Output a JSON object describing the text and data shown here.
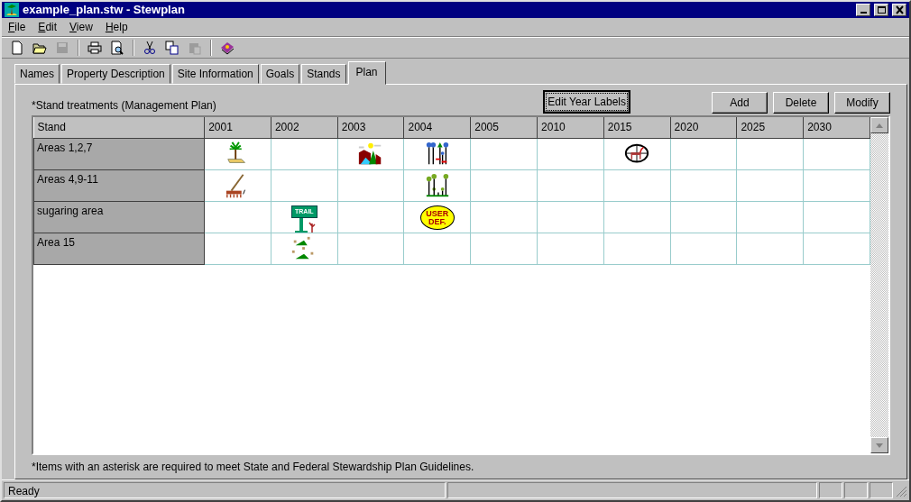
{
  "window": {
    "title": "example_plan.stw - Stewplan"
  },
  "menu": [
    "File",
    "Edit",
    "View",
    "Help"
  ],
  "toolbar": [
    {
      "kind": "new",
      "disabled": false
    },
    {
      "kind": "open",
      "disabled": false
    },
    {
      "kind": "save",
      "disabled": true
    },
    {
      "kind": "sep"
    },
    {
      "kind": "print",
      "disabled": false
    },
    {
      "kind": "preview",
      "disabled": false
    },
    {
      "kind": "sep"
    },
    {
      "kind": "cut",
      "disabled": false
    },
    {
      "kind": "copy",
      "disabled": false
    },
    {
      "kind": "paste",
      "disabled": true
    },
    {
      "kind": "sep"
    },
    {
      "kind": "book",
      "disabled": false
    }
  ],
  "tabs": [
    {
      "label": "Names",
      "selected": false
    },
    {
      "label": "Property Description",
      "selected": false
    },
    {
      "label": "Site Information",
      "selected": false
    },
    {
      "label": "Goals",
      "selected": false
    },
    {
      "label": "Stands",
      "selected": false
    },
    {
      "label": "Plan",
      "selected": true
    }
  ],
  "plan": {
    "caption": "*Stand treatments (Management Plan)",
    "edit_button": "Edit Year Labels",
    "buttons": [
      "Add",
      "Delete",
      "Modify"
    ],
    "columns": [
      "Stand",
      "2001",
      "2002",
      "2003",
      "2004",
      "2005",
      "2010",
      "2015",
      "2020",
      "2025",
      "2030"
    ],
    "rows": [
      {
        "cells": [
          {
            "kind": "stand",
            "text": "Areas 1,2,7"
          },
          {
            "kind": "seedling"
          },
          {},
          {
            "kind": "scenic"
          },
          {
            "kind": "marked-trees"
          },
          {},
          {},
          {
            "kind": "wildlife"
          },
          {},
          {},
          {}
        ]
      },
      {
        "cells": [
          {
            "kind": "stand",
            "text": "Areas 4,9-11"
          },
          {
            "kind": "rake"
          },
          {},
          {},
          {
            "kind": "young-trees"
          },
          {},
          {},
          {},
          {},
          {},
          {}
        ]
      },
      {
        "cells": [
          {
            "kind": "stand",
            "text": "sugaring area"
          },
          {},
          {
            "kind": "trail",
            "label": "TRAIL"
          },
          {},
          {
            "kind": "user",
            "label": "USER DEF."
          },
          {},
          {},
          {},
          {},
          {},
          {}
        ]
      },
      {
        "cells": [
          {
            "kind": "stand",
            "text": "Area 15"
          },
          {},
          {
            "kind": "stumps"
          },
          {},
          {},
          {},
          {},
          {},
          {},
          {},
          {}
        ]
      }
    ],
    "footnote": "*Items with an asterisk are required to meet State and Federal Stewardship Plan Guidelines."
  },
  "status_bar": {
    "text": "Ready"
  }
}
